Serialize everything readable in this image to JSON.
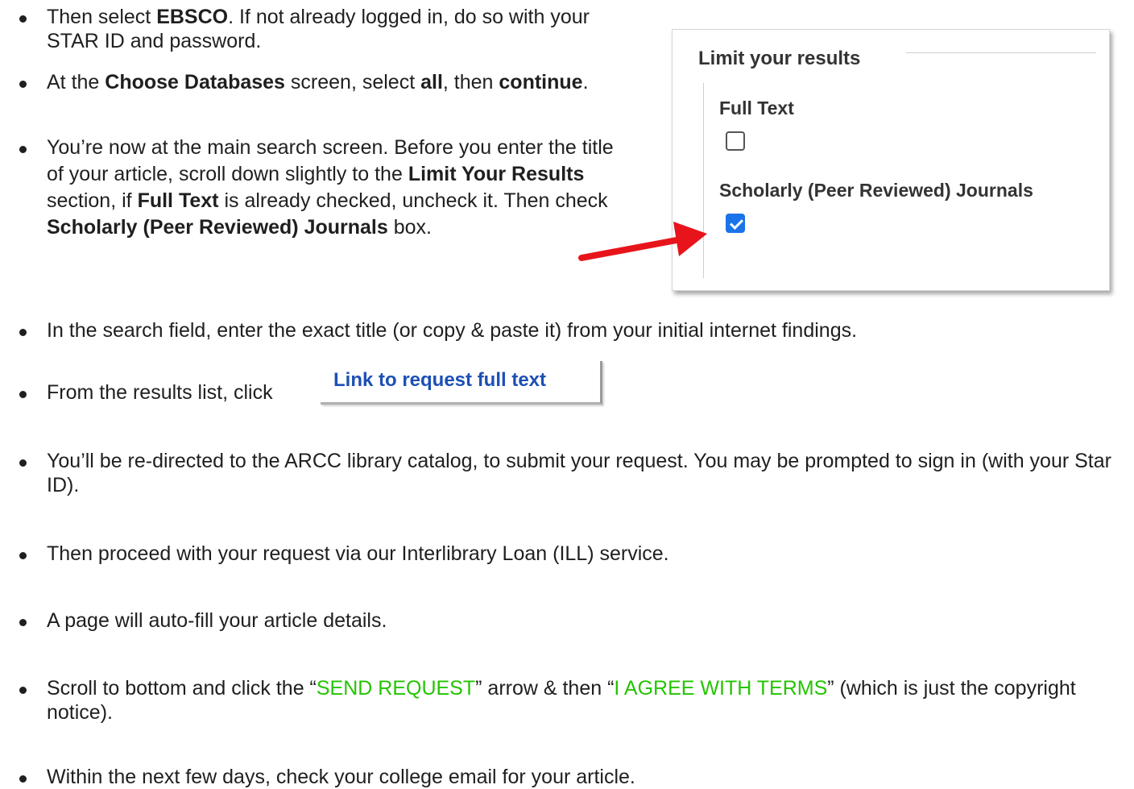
{
  "items": [
    {
      "parts": [
        "Then select ",
        "EBSCO",
        ". If not already logged in, do so with your STAR ID and password."
      ]
    },
    {
      "parts": [
        "At the ",
        "Choose Databases",
        " screen, select ",
        "all",
        ", then ",
        "continue",
        "."
      ]
    },
    {
      "parts": [
        "You’re now at the main search screen. Before you enter the title of your article, scroll down slightly to the ",
        "Limit Your Results",
        " section, if ",
        "Full Text",
        " is already checked, uncheck it. Then check ",
        "Scholarly (Peer Reviewed) Journals",
        " box."
      ]
    },
    {
      "text": "In the search field, enter the exact title (or copy & paste it) from your initial internet findings."
    },
    {
      "text": "From the results list, click"
    },
    {
      "text": "You’ll be re-directed to the ARCC library catalog, to submit your request. You may be prompted to sign in (with your Star ID)."
    },
    {
      "text": "Then proceed with your request via our Interlibrary Loan (ILL) service."
    },
    {
      "text": "A page will auto-fill your article details."
    },
    {
      "parts": [
        "Scroll to bottom and click the “",
        "SEND REQUEST",
        "” arrow & then “",
        "I AGREE WITH TERMS",
        "” (which is just the copyright notice)."
      ]
    },
    {
      "text": "Within the next few days, check your college email for your article."
    }
  ],
  "panel": {
    "title": "Limit your results",
    "options": [
      {
        "label": "Full Text",
        "checked": false
      },
      {
        "label": "Scholarly (Peer Reviewed) Journals",
        "checked": true
      }
    ]
  },
  "link_button": {
    "label": "Link to request full text"
  },
  "colors": {
    "highlight_green": "#24c400",
    "arrow_red": "#e8141b",
    "link_blue": "#1d4fb5"
  }
}
